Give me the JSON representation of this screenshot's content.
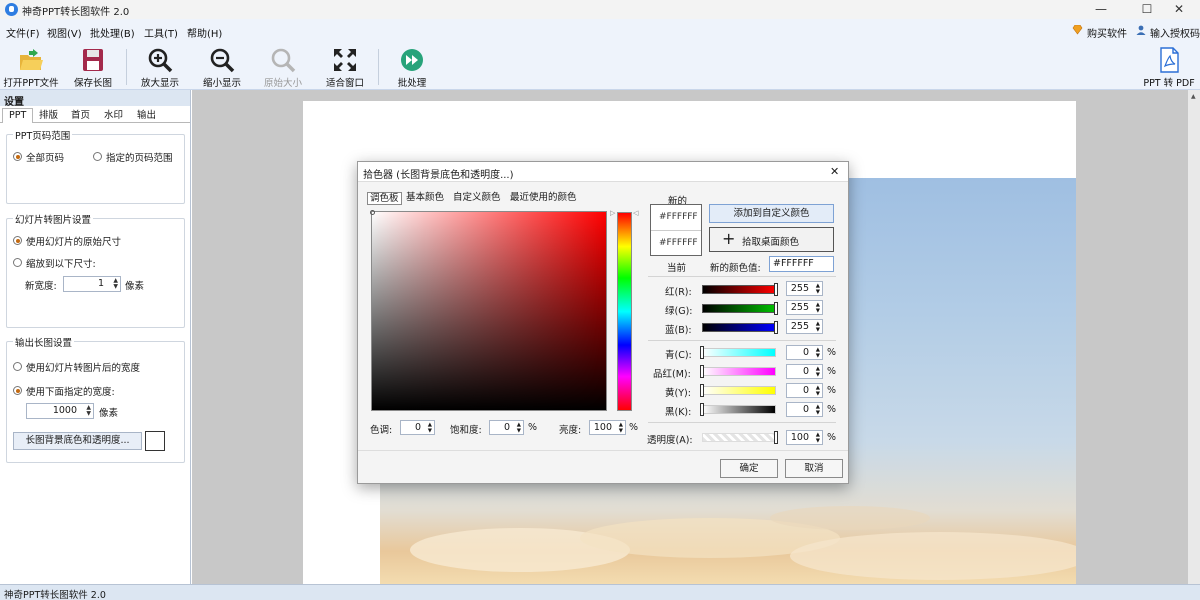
{
  "window": {
    "title": "神奇PPT转长图软件 2.0",
    "minimize": "—",
    "maximize": "☐",
    "close": "✕"
  },
  "menu": [
    "文件(F)",
    "视图(V)",
    "批处理(B)",
    "工具(T)",
    "帮助(H)"
  ],
  "menu_right": {
    "buy": "购买软件",
    "license": "输入授权码"
  },
  "toolbar": {
    "open": "打开PPT文件",
    "save": "保存长图",
    "zoom_in": "放大显示",
    "zoom_out": "缩小显示",
    "original": "原始大小",
    "fit": "适合窗口",
    "batch": "批处理",
    "ppt2pdf": "PPT 转 PDF"
  },
  "settings": {
    "title": "设置",
    "tabs": [
      "PPT",
      "排版",
      "首页",
      "水印",
      "输出"
    ],
    "page_range": {
      "title": "PPT页码范围",
      "all": "全部页码",
      "specified": "指定的页码范围"
    },
    "slide": {
      "title": "幻灯片转图片设置",
      "original": "使用幻灯片的原始尺寸",
      "scale": "缩放到以下尺寸:",
      "width_label": "新宽度:",
      "width_value": "1",
      "unit": "像素"
    },
    "output": {
      "title": "输出长图设置",
      "use_slide_width": "使用幻灯片转图片后的宽度",
      "use_specified": "使用下面指定的宽度:",
      "width_value": "1000",
      "unit": "像素",
      "bg_button": "长图背景底色和透明度..."
    }
  },
  "statusbar": "神奇PPT转长图软件 2.0",
  "dialog": {
    "title": "拾色器 (长图背景底色和透明度...)",
    "close": "✕",
    "tabs": [
      "调色板",
      "基本颜色",
      "自定义颜色",
      "最近使用的颜色"
    ],
    "new_label": "新的",
    "current_label": "当前",
    "new_hex": "#FFFFFF",
    "current_hex": "#FFFFFF",
    "add_custom": "添加到自定义颜色",
    "pick_desktop": "拾取桌面颜色",
    "new_value_label": "新的颜色值:",
    "new_value": "#FFFFFF",
    "rgb": [
      {
        "label": "红(R):",
        "value": "255",
        "color": "#ff0000"
      },
      {
        "label": "绿(G):",
        "value": "255",
        "color": "#00c000"
      },
      {
        "label": "蓝(B):",
        "value": "255",
        "color": "#0000ff"
      }
    ],
    "cmyk": [
      {
        "label": "青(C):",
        "value": "0",
        "unit": "%",
        "color": "#00ffff"
      },
      {
        "label": "品红(M):",
        "value": "0",
        "unit": "%",
        "color": "#ff00ff"
      },
      {
        "label": "黄(Y):",
        "value": "0",
        "unit": "%",
        "color": "#ffff00"
      },
      {
        "label": "黑(K):",
        "value": "0",
        "unit": "%",
        "color": "#000000"
      }
    ],
    "alpha": {
      "label": "透明度(A):",
      "value": "100",
      "unit": "%"
    },
    "hue": {
      "label": "色调:",
      "value": "0"
    },
    "saturation": {
      "label": "饱和度:",
      "value": "0",
      "unit": "%"
    },
    "brightness": {
      "label": "亮度:",
      "value": "100",
      "unit": "%"
    },
    "ok": "确定",
    "cancel": "取消"
  }
}
